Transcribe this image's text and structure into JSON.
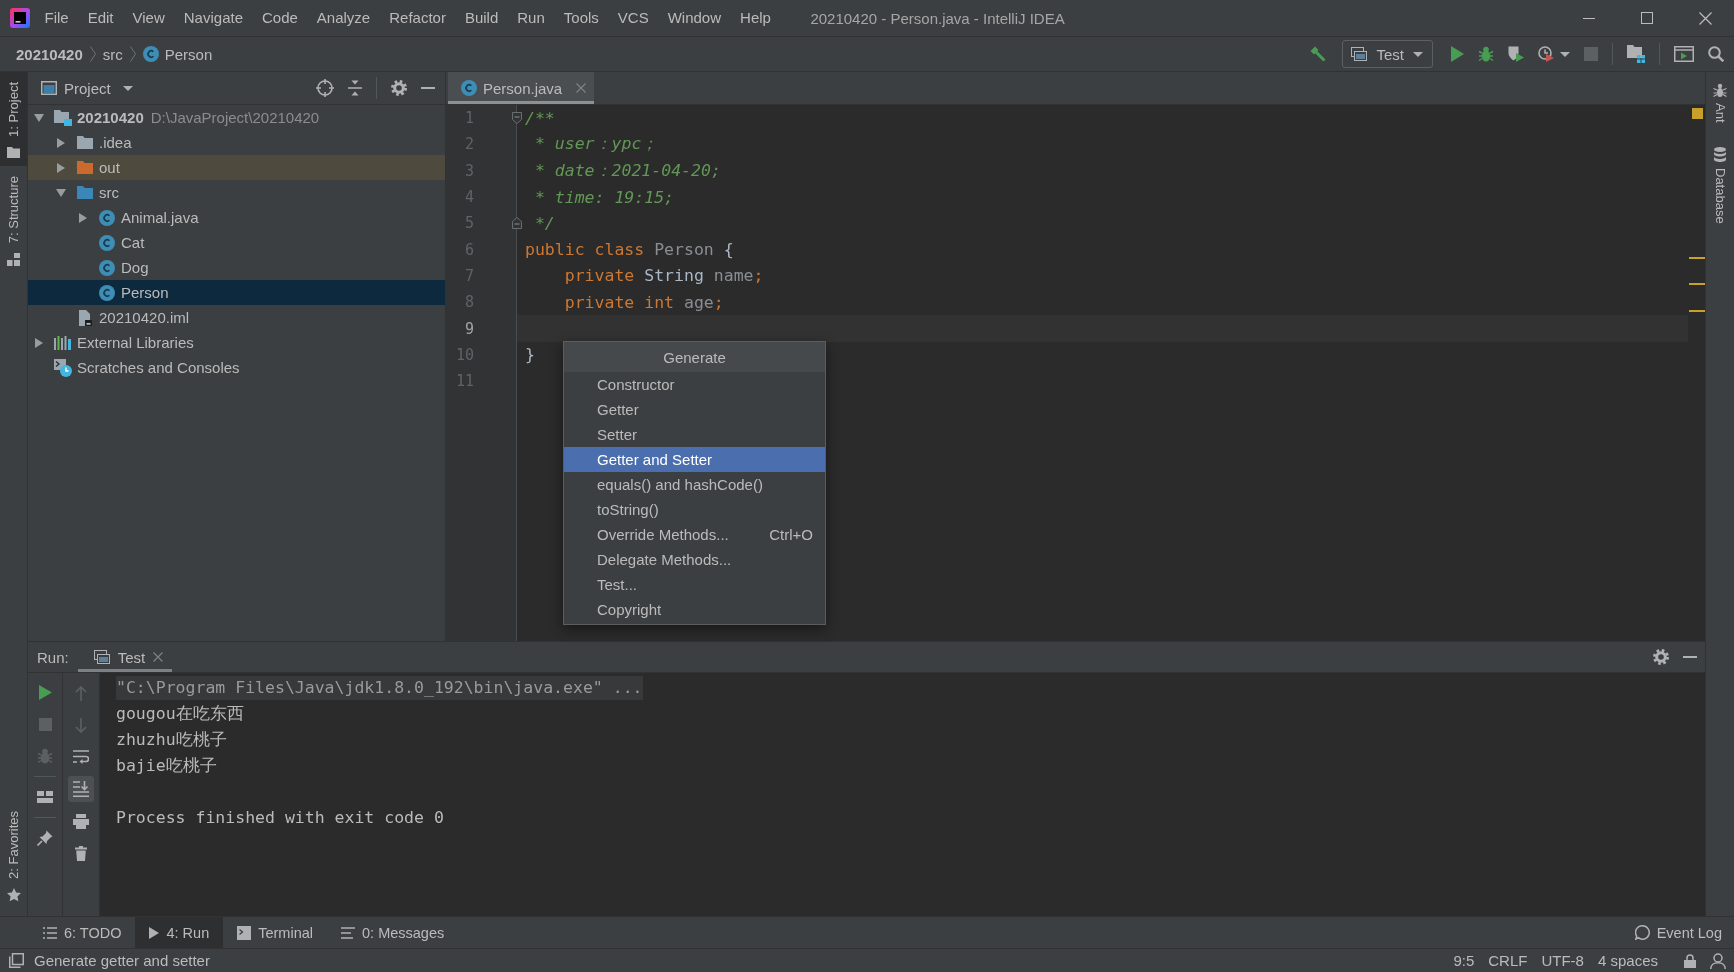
{
  "window": {
    "title": "20210420 - Person.java - IntelliJ IDEA"
  },
  "menu": [
    {
      "label": "File"
    },
    {
      "label": "Edit"
    },
    {
      "label": "View"
    },
    {
      "label": "Navigate"
    },
    {
      "label": "Code"
    },
    {
      "label": "Analyze"
    },
    {
      "label": "Refactor"
    },
    {
      "label": "Build"
    },
    {
      "label": "Run"
    },
    {
      "label": "Tools"
    },
    {
      "label": "VCS"
    },
    {
      "label": "Window"
    },
    {
      "label": "Help"
    }
  ],
  "navigation_bar": {
    "breadcrumbs": [
      {
        "label": "20210420",
        "kind": "project"
      },
      {
        "label": "src",
        "kind": "folder"
      },
      {
        "label": "Person",
        "kind": "class"
      }
    ],
    "toolbar": [
      {
        "kind": "build",
        "disabled": false
      },
      {
        "kind": "run_config",
        "label": "Test",
        "disabled": false
      },
      {
        "kind": "run",
        "disabled": false
      },
      {
        "kind": "debug",
        "disabled": false
      },
      {
        "kind": "coverage",
        "disabled": false
      },
      {
        "kind": "profile",
        "disabled": false
      },
      {
        "kind": "stop",
        "disabled": true
      },
      {
        "kind": "project_structure",
        "disabled": false
      },
      {
        "kind": "run_anything",
        "disabled": false
      },
      {
        "kind": "search",
        "disabled": false
      }
    ]
  },
  "left_stripe": {
    "top": [
      {
        "label": "1: Project",
        "kind": "project",
        "selected": true
      },
      {
        "label": "7: Structure",
        "kind": "structure",
        "selected": false
      }
    ],
    "bottom": [
      {
        "label": "2: Favorites",
        "kind": "favorites",
        "selected": false
      }
    ]
  },
  "project_panel": {
    "title": "Project",
    "tree": [
      {
        "label": "20210420",
        "path": "D:\\JavaProject\\20210420",
        "kind": "module",
        "expanded": true,
        "selected": false,
        "highlighted": false,
        "children": [
          {
            "label": ".idea",
            "kind": "folder",
            "expanded": false,
            "selected": false,
            "highlighted": false
          },
          {
            "label": "out",
            "kind": "excluded_folder",
            "expanded": false,
            "selected": false,
            "highlighted": true
          },
          {
            "label": "src",
            "kind": "source_folder",
            "expanded": true,
            "selected": false,
            "highlighted": false,
            "children": [
              {
                "label": "Animal.java",
                "kind": "class",
                "expanded": false,
                "selected": false,
                "highlighted": false
              },
              {
                "label": "Cat",
                "kind": "class",
                "selected": false,
                "highlighted": false
              },
              {
                "label": "Dog",
                "kind": "class",
                "selected": false,
                "highlighted": false
              },
              {
                "label": "Person",
                "kind": "class",
                "selected": true,
                "highlighted": false
              }
            ]
          },
          {
            "label": "20210420.iml",
            "kind": "module_file",
            "selected": false,
            "highlighted": false
          }
        ]
      },
      {
        "label": "External Libraries",
        "kind": "libraries",
        "expanded": false,
        "selected": false,
        "highlighted": false
      },
      {
        "label": "Scratches and Consoles",
        "kind": "scratches",
        "selected": false,
        "highlighted": false
      }
    ]
  },
  "editor": {
    "tabs": [
      {
        "label": "Person.java",
        "selected": true
      }
    ],
    "lines": [
      {
        "number": "1",
        "current": false,
        "fold_start": true,
        "fold_end": false,
        "tokens": [
          {
            "text": "/**",
            "kind": "comment"
          }
        ]
      },
      {
        "number": "2",
        "current": false,
        "fold_start": false,
        "fold_end": false,
        "tokens": [
          {
            "text": " * user：ypc；",
            "kind": "comment"
          }
        ]
      },
      {
        "number": "3",
        "current": false,
        "fold_start": false,
        "fold_end": false,
        "tokens": [
          {
            "text": " * date：2021-04-20;",
            "kind": "comment"
          }
        ]
      },
      {
        "number": "4",
        "current": false,
        "fold_start": false,
        "fold_end": false,
        "tokens": [
          {
            "text": " * time: 19:15;",
            "kind": "comment"
          }
        ]
      },
      {
        "number": "5",
        "current": false,
        "fold_start": false,
        "fold_end": true,
        "tokens": [
          {
            "text": " */",
            "kind": "comment"
          }
        ]
      },
      {
        "number": "6",
        "current": false,
        "fold_start": false,
        "fold_end": false,
        "tokens": [
          {
            "text": "public class",
            "kind": "keyword"
          },
          {
            "text": " Person",
            "kind": "unused"
          },
          {
            "text": " {",
            "kind": "plain"
          }
        ]
      },
      {
        "number": "7",
        "current": false,
        "fold_start": false,
        "fold_end": false,
        "tokens": [
          {
            "text": "    private",
            "kind": "keyword"
          },
          {
            "text": " String",
            "kind": "plain"
          },
          {
            "text": " name",
            "kind": "unused"
          },
          {
            "text": ";",
            "kind": "keyword"
          }
        ]
      },
      {
        "number": "8",
        "current": false,
        "fold_start": false,
        "fold_end": false,
        "tokens": [
          {
            "text": "    private int",
            "kind": "keyword"
          },
          {
            "text": " age",
            "kind": "unused"
          },
          {
            "text": ";",
            "kind": "keyword"
          }
        ]
      },
      {
        "number": "9",
        "current": true,
        "fold_start": false,
        "fold_end": false
      },
      {
        "number": "10",
        "current": false,
        "fold_start": false,
        "fold_end": false,
        "tokens": [
          {
            "text": "}",
            "kind": "plain"
          }
        ]
      },
      {
        "number": "11",
        "current": false,
        "fold_start": false,
        "fold_end": false
      }
    ],
    "popup": {
      "title": "Generate",
      "items": [
        {
          "label": "Constructor",
          "selected": false
        },
        {
          "label": "Getter",
          "selected": false
        },
        {
          "label": "Setter",
          "selected": false
        },
        {
          "label": "Getter and Setter",
          "selected": true
        },
        {
          "label": "equals() and hashCode()",
          "selected": false
        },
        {
          "label": "toString()",
          "selected": false
        },
        {
          "label": "Override Methods...",
          "shortcut": "Ctrl+O",
          "selected": false
        },
        {
          "label": "Delegate Methods...",
          "selected": false
        },
        {
          "label": "Test...",
          "selected": false
        },
        {
          "label": "Copyright",
          "selected": false
        }
      ]
    }
  },
  "right_stripe": [
    {
      "label": "Ant",
      "kind": "ant",
      "selected": false
    },
    {
      "label": "Database",
      "kind": "database",
      "selected": false
    }
  ],
  "run_panel": {
    "label": "Run:",
    "tabs": [
      {
        "label": "Test",
        "selected": true
      }
    ],
    "toolbar_columns": [
      {
        "buttons": [
          {
            "kind": "rerun",
            "disabled": false,
            "on": false
          },
          {
            "kind": "stop",
            "disabled": true,
            "on": false
          },
          {
            "kind": "rerun_failed",
            "disabled": true,
            "on": false
          },
          {
            "kind": "layout",
            "disabled": false,
            "on": false
          },
          {
            "kind": "pin",
            "disabled": false,
            "on": false
          }
        ]
      },
      {
        "buttons": [
          {
            "kind": "previous",
            "disabled": true,
            "on": false
          },
          {
            "kind": "next",
            "disabled": true,
            "on": false
          },
          {
            "kind": "soft_wrap",
            "disabled": false,
            "on": false
          },
          {
            "kind": "scroll_to_end",
            "disabled": false,
            "on": true
          },
          {
            "kind": "print",
            "disabled": false,
            "on": false
          },
          {
            "kind": "clear",
            "disabled": false,
            "on": false
          }
        ]
      }
    ],
    "console": [
      {
        "kind": "command",
        "text": "\"C:\\Program Files\\Java\\jdk1.8.0_192\\bin\\java.exe\" ..."
      },
      {
        "kind": "output",
        "text": "gougou在吃东西"
      },
      {
        "kind": "output",
        "text": "zhuzhu吃桃子"
      },
      {
        "kind": "output",
        "text": "bajie吃桃子"
      },
      {
        "kind": "exit",
        "text": "Process finished with exit code 0"
      }
    ]
  },
  "tool_window_bar": {
    "items": [
      {
        "label": "6: TODO",
        "kind": "todo",
        "selected": false
      },
      {
        "label": "4: Run",
        "kind": "run",
        "selected": true
      },
      {
        "label": "Terminal",
        "kind": "terminal",
        "selected": false
      },
      {
        "label": "0: Messages",
        "kind": "messages",
        "selected": false
      }
    ],
    "event_log": {
      "label": "Event Log"
    }
  },
  "status_bar": {
    "message": "Generate getter and setter",
    "widgets": [
      "9:5",
      "CRLF",
      "UTF-8",
      "4 spaces"
    ]
  }
}
